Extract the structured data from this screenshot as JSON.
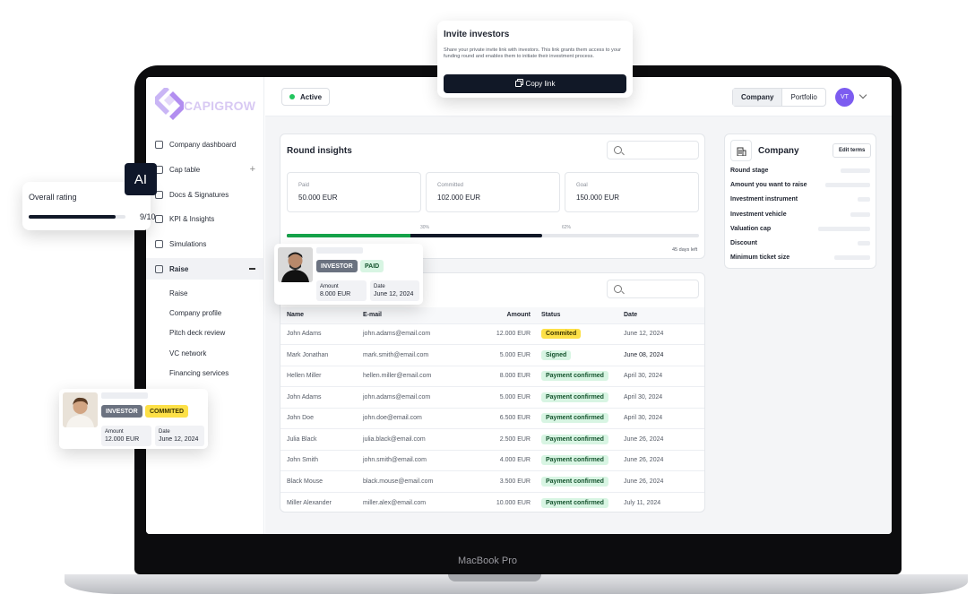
{
  "app": {
    "brand": "CAPIGROW",
    "device_label": "MacBook Pro"
  },
  "colors": {
    "accent": "#7c5cf0",
    "primary_dark": "#111827",
    "commited": "#fde047",
    "confirmed": "#d8f5e3"
  },
  "sidebar": {
    "items": [
      {
        "label": "Company dashboard",
        "icon": "dashboard-icon"
      },
      {
        "label": "Cap table",
        "icon": "cap-table-icon"
      },
      {
        "label": "Docs & Signatures",
        "icon": "documents-icon"
      },
      {
        "label": "KPI & Insights",
        "icon": "chart-icon"
      },
      {
        "label": "Simulations",
        "icon": "simulation-icon"
      },
      {
        "label": "Raise",
        "icon": "wallet-icon"
      }
    ],
    "sub_items": [
      "Raise",
      "Company profile",
      "Pitch deck review",
      "VC network",
      "Financing services"
    ]
  },
  "topbar": {
    "status": "Active",
    "tabs": [
      "Company",
      "Portfolio"
    ],
    "avatar_initials": "VT"
  },
  "invite": {
    "title": "Invite investors",
    "description": "Share your private invite link with investors. This link grants them access to your funding round and enables them to initiate their investment process.",
    "button": "Copy link"
  },
  "insights": {
    "title": "Round insights",
    "stats": [
      {
        "label": "Paid",
        "value": "50.000 EUR"
      },
      {
        "label": "Committed",
        "value": "102.000 EUR"
      },
      {
        "label": "Goal",
        "value": "150.000 EUR"
      }
    ],
    "progress": {
      "paid_pct": "30%",
      "committed_pct": "62%",
      "paid": 0.3,
      "committed": 0.62,
      "days_left": "45 days left"
    }
  },
  "table": {
    "headers": [
      "Name",
      "E-mail",
      "Amount",
      "Status",
      "Date"
    ],
    "rows": [
      [
        "John Adams",
        "john.adams@email.com",
        "12.000 EUR",
        "Commited",
        "June 12, 2024"
      ],
      [
        "Mark Jonathan",
        "mark.smith@email.com",
        "5.000 EUR",
        "Signed",
        "June 08, 2024"
      ],
      [
        "Hellen Miller",
        "hellen.miller@email.com",
        "8.000 EUR",
        "Payment confirmed",
        "April 30, 2024"
      ],
      [
        "John Adams",
        "john.adams@email.com",
        "5.000 EUR",
        "Payment confirmed",
        "April 30, 2024"
      ],
      [
        "John Doe",
        "john.doe@email.com",
        "6.500 EUR",
        "Payment confirmed",
        "April 30, 2024"
      ],
      [
        "Julia Black",
        "julia.black@email.com",
        "2.500 EUR",
        "Payment confirmed",
        "June 26, 2024"
      ],
      [
        "John Smith",
        "john.smith@email.com",
        "4.000 EUR",
        "Payment confirmed",
        "June 26, 2024"
      ],
      [
        "Black Mouse",
        "black.mouse@email.com",
        "3.500 EUR",
        "Payment confirmed",
        "June 26, 2024"
      ],
      [
        "Miller Alexander",
        "miller.alex@email.com",
        "10.000 EUR",
        "Payment confirmed",
        "July 11, 2024"
      ]
    ]
  },
  "company": {
    "title": "Company",
    "edit_label": "Edit terms",
    "fields": [
      "Round stage",
      "Amount you want to raise",
      "Investment instrument",
      "Investment vehicle",
      "Valuation cap",
      "Discount",
      "Minimum ticket size"
    ]
  },
  "rating": {
    "badge": "AI",
    "label": "Overall rating",
    "score": "9/10",
    "value": 0.9
  },
  "investor_card_1": {
    "role": "INVESTOR",
    "status": "PAID",
    "amount_label": "Amount",
    "amount": "8.000 EUR",
    "date_label": "Date",
    "date": "June 12, 2024"
  },
  "investor_card_2": {
    "role": "INVESTOR",
    "status": "COMMITED",
    "amount_label": "Amount",
    "amount": "12.000 EUR",
    "date_label": "Date",
    "date": "June 12, 2024"
  }
}
